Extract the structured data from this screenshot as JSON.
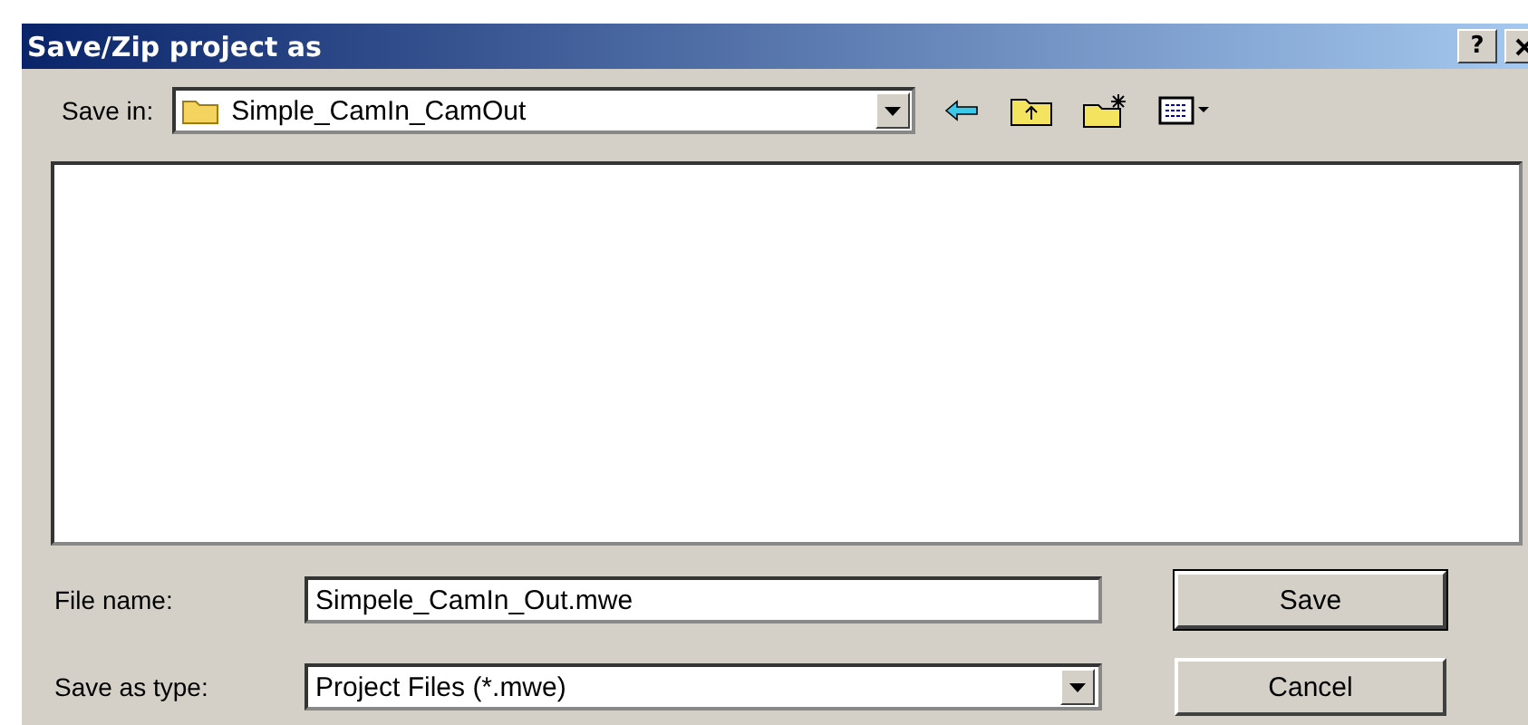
{
  "window": {
    "title": "Save/Zip project as",
    "help_button": "?"
  },
  "save_in": {
    "label": "Save in:",
    "value": "Simple_CamIn_CamOut"
  },
  "file_name": {
    "label": "File name:",
    "value": "Simpele_CamIn_Out.mwe"
  },
  "save_as_type": {
    "label": "Save as type:",
    "value": "Project Files (*.mwe)"
  },
  "buttons": [
    {
      "label": "Save",
      "default": true
    },
    {
      "label": "Cancel",
      "default": false
    }
  ]
}
